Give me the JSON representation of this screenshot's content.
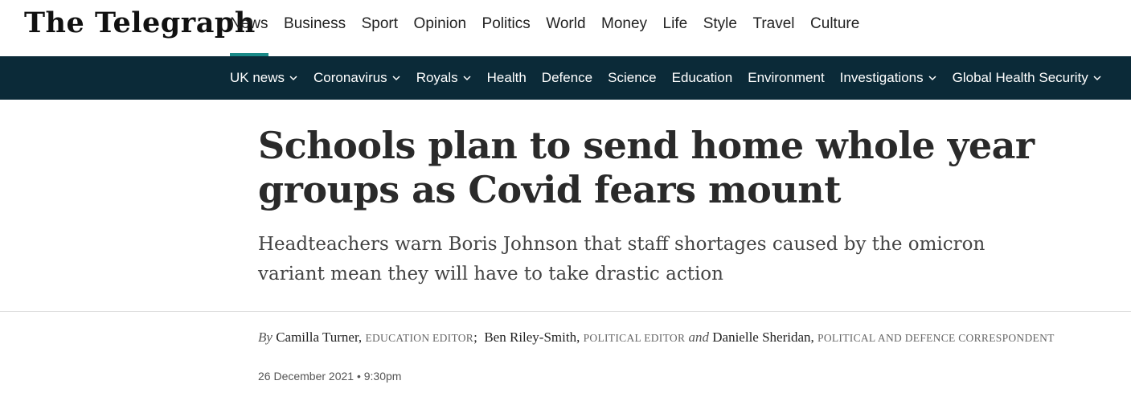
{
  "site": {
    "logo_text": "The Telegraph"
  },
  "primary_nav": {
    "items": [
      "News",
      "Business",
      "Sport",
      "Opinion",
      "Politics",
      "World",
      "Money",
      "Life",
      "Style",
      "Travel",
      "Culture"
    ],
    "active": "News"
  },
  "secondary_nav": {
    "items": [
      {
        "label": "UK news",
        "has_dropdown": true
      },
      {
        "label": "Coronavirus",
        "has_dropdown": true
      },
      {
        "label": "Royals",
        "has_dropdown": true
      },
      {
        "label": "Health",
        "has_dropdown": false
      },
      {
        "label": "Defence",
        "has_dropdown": false
      },
      {
        "label": "Science",
        "has_dropdown": false
      },
      {
        "label": "Education",
        "has_dropdown": false
      },
      {
        "label": "Environment",
        "has_dropdown": false
      },
      {
        "label": "Investigations",
        "has_dropdown": true
      },
      {
        "label": "Global Health Security",
        "has_dropdown": true
      }
    ]
  },
  "article": {
    "headline": "Schools plan to send home whole year groups as Covid fears mount",
    "standfirst": "Headteachers warn Boris Johnson that staff shortages caused by the omicron variant mean they will have to take drastic action",
    "byline": {
      "prefix": "By",
      "authors": [
        {
          "name": "Camilla Turner,",
          "role": "Education Editor"
        },
        {
          "name": "Ben Riley-Smith,",
          "role": "Political Editor"
        },
        {
          "name": "Danielle Sheridan,",
          "role": "Political and Defence Correspondent"
        }
      ],
      "separator": ";",
      "conjunction": "and"
    },
    "published": "26 December 2021 • 9:30pm"
  },
  "colors": {
    "subnav_bg": "#0b2a38",
    "active_underline": "#1a8a88"
  }
}
